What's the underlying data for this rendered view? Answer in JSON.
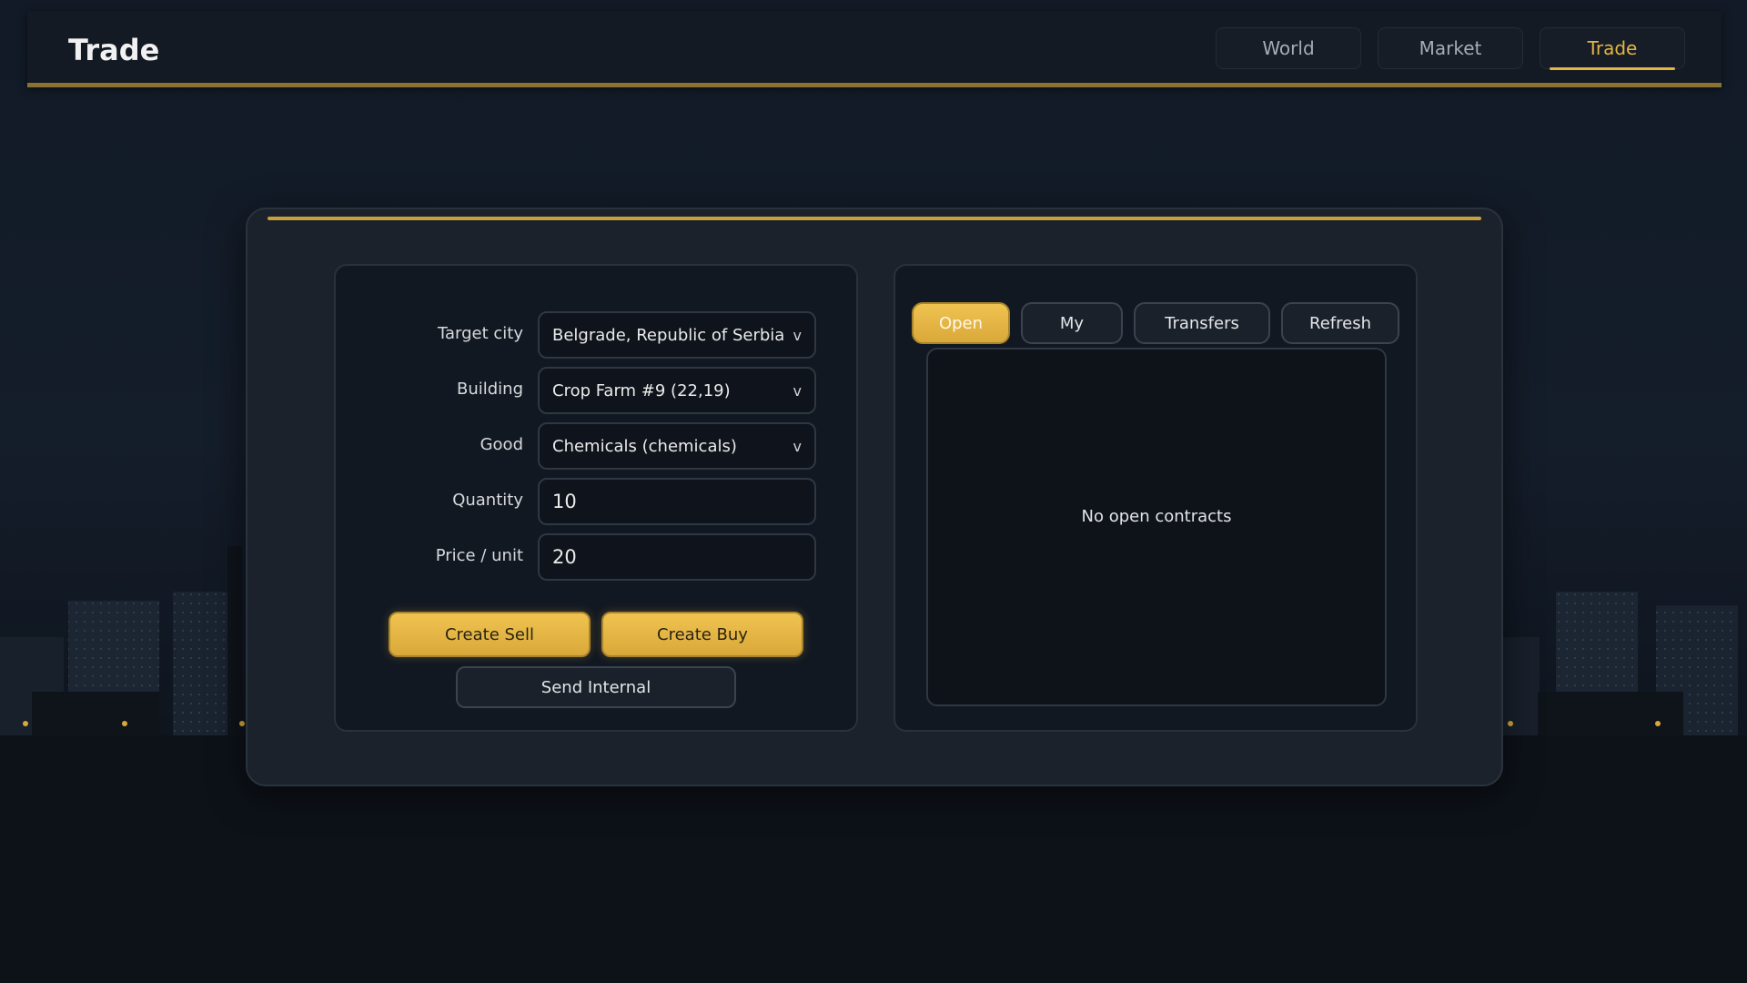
{
  "header": {
    "title": "Trade",
    "nav": [
      {
        "label": "World",
        "active": false
      },
      {
        "label": "Market",
        "active": false
      },
      {
        "label": "Trade",
        "active": true
      }
    ]
  },
  "form": {
    "target_city": {
      "label": "Target city",
      "value": "Belgrade, Republic of Serbia"
    },
    "building": {
      "label": "Building",
      "value": "Crop Farm #9 (22,19)"
    },
    "good": {
      "label": "Good",
      "value": "Chemicals (chemicals)"
    },
    "quantity": {
      "label": "Quantity",
      "value": "10"
    },
    "price": {
      "label": "Price / unit",
      "value": "20"
    },
    "dropdown_glyph": "v",
    "create_sell_label": "Create Sell",
    "create_buy_label": "Create Buy",
    "send_internal_label": "Send Internal"
  },
  "contracts": {
    "tabs": [
      {
        "label": "Open",
        "active": true
      },
      {
        "label": "My",
        "active": false
      },
      {
        "label": "Transfers",
        "active": false
      },
      {
        "label": "Refresh",
        "active": false
      }
    ],
    "empty_message": "No open contracts"
  },
  "colors": {
    "accent": "#e4b544",
    "background": "#131a24",
    "panel": "#1b222c"
  }
}
